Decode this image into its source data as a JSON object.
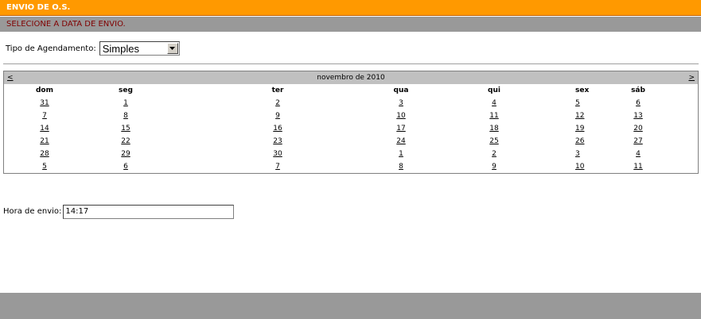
{
  "header": {
    "title": "ENVIO DE O.S.",
    "subtitle": "SELECIONE A DATA DE ENVIO."
  },
  "tipo": {
    "label": "Tipo de Agendamento:",
    "selected": "Simples"
  },
  "calendar": {
    "prev": "<",
    "next": ">",
    "month_label": "novembro de 2010",
    "weekdays": [
      "dom",
      "seg",
      "ter",
      "qua",
      "qui",
      "sex",
      "sáb"
    ],
    "weeks": [
      [
        "31",
        "1",
        "2",
        "3",
        "4",
        "5",
        "6"
      ],
      [
        "7",
        "8",
        "9",
        "10",
        "11",
        "12",
        "13"
      ],
      [
        "14",
        "15",
        "16",
        "17",
        "18",
        "19",
        "20"
      ],
      [
        "21",
        "22",
        "23",
        "24",
        "25",
        "26",
        "27"
      ],
      [
        "28",
        "29",
        "30",
        "1",
        "2",
        "3",
        "4"
      ],
      [
        "5",
        "6",
        "7",
        "8",
        "9",
        "10",
        "11"
      ]
    ]
  },
  "hora": {
    "label": "Hora de envio:",
    "value": "14:17"
  },
  "colors": {
    "title_bar": "#ff9900",
    "sub_bar": "#999999",
    "sub_text": "#800000",
    "footer": "#999999"
  }
}
